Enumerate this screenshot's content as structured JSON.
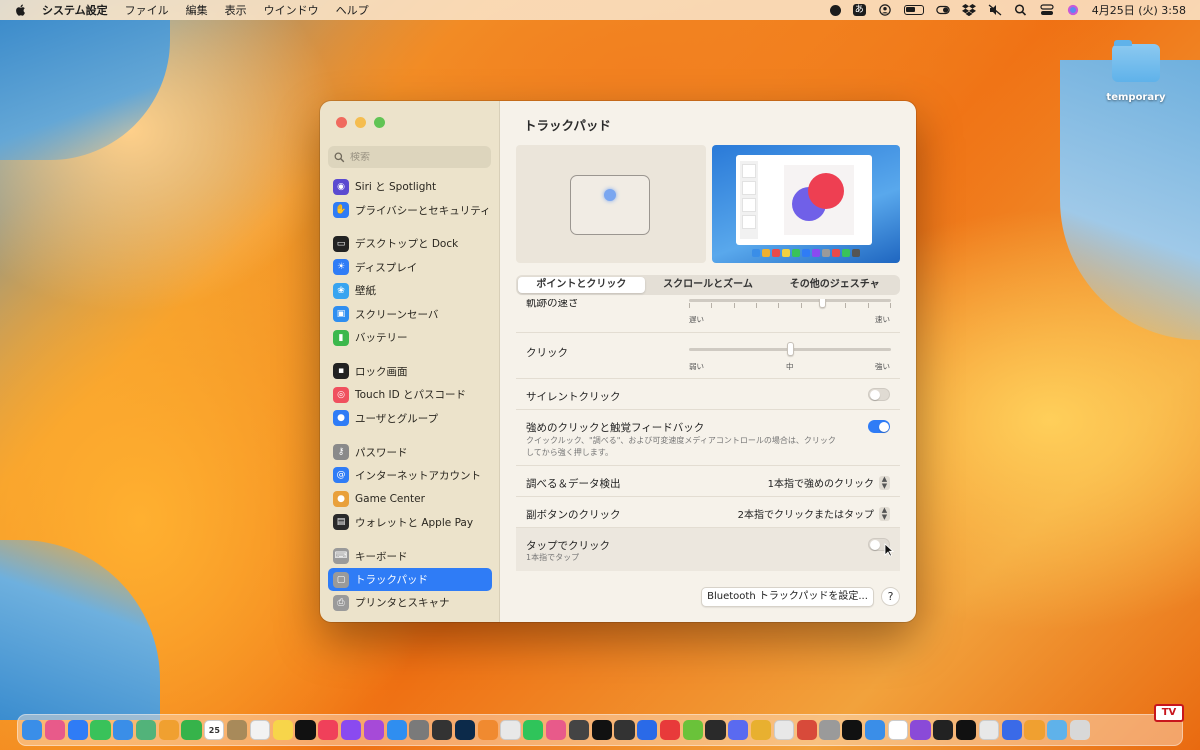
{
  "menubar": {
    "app_name": "システム設定",
    "menus": [
      "ファイル",
      "編集",
      "表示",
      "ウインドウ",
      "ヘルプ"
    ],
    "status_icons": [
      "record-icon",
      "input-method-icon",
      "user-icon",
      "battery-icon",
      "toggle-icon",
      "dropbox-icon",
      "mute-icon",
      "search-icon",
      "control-center-icon",
      "siri-icon"
    ],
    "input_method_label": "あ",
    "datetime": "4月25日 (火)  3:58"
  },
  "desktop": {
    "folder_label": "temporary"
  },
  "window": {
    "search_placeholder": "検索",
    "title": "トラックパッド",
    "sidebar": [
      {
        "label": "Siri と Spotlight",
        "icon": "siri-icon",
        "color": "#5b4ad0"
      },
      {
        "label": "プライバシーとセキュリティ",
        "icon": "hand-icon",
        "color": "#2f7cf6"
      },
      {
        "label": "デスクトップと Dock",
        "icon": "desktop-icon",
        "color": "#222222"
      },
      {
        "label": "ディスプレイ",
        "icon": "sun-icon",
        "color": "#2f7cf6"
      },
      {
        "label": "壁紙",
        "icon": "flower-icon",
        "color": "#38a4f0"
      },
      {
        "label": "スクリーンセーバ",
        "icon": "screensaver-icon",
        "color": "#2f8ef0"
      },
      {
        "label": "バッテリー",
        "icon": "battery-icon",
        "color": "#3cb84c"
      },
      {
        "label": "ロック画面",
        "icon": "lock-icon",
        "color": "#222222"
      },
      {
        "label": "Touch ID とパスコード",
        "icon": "fingerprint-icon",
        "color": "#f0505e"
      },
      {
        "label": "ユーザとグループ",
        "icon": "users-icon",
        "color": "#2f7cf6"
      },
      {
        "label": "パスワード",
        "icon": "key-icon",
        "color": "#8a8a8a"
      },
      {
        "label": "インターネットアカウント",
        "icon": "at-icon",
        "color": "#2f7cf6"
      },
      {
        "label": "Game Center",
        "icon": "game-center-icon",
        "color": "#e9a03a"
      },
      {
        "label": "ウォレットと Apple Pay",
        "icon": "wallet-icon",
        "color": "#2a2a2a"
      },
      {
        "label": "キーボード",
        "icon": "keyboard-icon",
        "color": "#9a9a9a"
      },
      {
        "label": "トラックパッド",
        "icon": "trackpad-icon",
        "color": "#9a9a9a"
      },
      {
        "label": "プリンタとスキャナ",
        "icon": "printer-icon",
        "color": "#9a9a9a"
      }
    ],
    "tabs": [
      "ポイントとクリック",
      "スクロールとズーム",
      "その他のジェスチャ"
    ],
    "active_tab": "ポイントとクリック",
    "rows": {
      "tracking": {
        "label": "軌跡の速さ",
        "min_label": "遅い",
        "max_label": "速い",
        "value": 0.66
      },
      "click": {
        "label": "クリック",
        "min_label": "弱い",
        "mid_label": "中",
        "max_label": "強い",
        "value": 0.5
      },
      "silent_click": {
        "label": "サイレントクリック",
        "on": false
      },
      "force_click": {
        "label": "強めのクリックと触覚フィードバック",
        "desc_1": "クイックルック、\"調べる\"、および可変速度メディアコントロールの場合は、クリック",
        "desc_2": "してから強く押します。",
        "on": true
      },
      "lookup": {
        "label": "調べる＆データ検出",
        "value": "1本指で強めのクリック"
      },
      "secondary_click": {
        "label": "副ボタンのクリック",
        "value": "2本指でクリックまたはタップ"
      },
      "tap_to_click": {
        "label": "タップでクリック",
        "desc": "1本指でタップ",
        "on": false
      }
    },
    "bluetooth_button": "Bluetooth トラックパッドを設定...",
    "help_button": "?"
  },
  "dock": {
    "calendar_day": "25",
    "tv_logo": "TV",
    "apps": [
      {
        "name": "finder",
        "color": "#3a8ee8"
      },
      {
        "name": "launchpad",
        "color": "#e85a8a"
      },
      {
        "name": "safari",
        "color": "#2f7cf6"
      },
      {
        "name": "messages",
        "color": "#39c25a"
      },
      {
        "name": "mail",
        "color": "#3a8ee8"
      },
      {
        "name": "maps",
        "color": "#52b37a"
      },
      {
        "name": "photos",
        "color": "#f0a030"
      },
      {
        "name": "facetime",
        "color": "#36b34a"
      },
      {
        "name": "calendar",
        "color": "#ffffff"
      },
      {
        "name": "notes-brown",
        "color": "#a88a5a"
      },
      {
        "name": "reminders",
        "color": "#f2f2f2"
      },
      {
        "name": "notes",
        "color": "#f7d54a"
      },
      {
        "name": "tv",
        "color": "#111111"
      },
      {
        "name": "music",
        "color": "#f0405a"
      },
      {
        "name": "itunes-star",
        "color": "#8a4af0"
      },
      {
        "name": "podcasts",
        "color": "#a64ad8"
      },
      {
        "name": "app-store",
        "color": "#2f8ef0"
      },
      {
        "name": "settings",
        "color": "#7a7a7a"
      },
      {
        "name": "claquette",
        "color": "#333333"
      },
      {
        "name": "photoshop",
        "color": "#0c2a4a"
      },
      {
        "name": "pages",
        "color": "#f08a30"
      },
      {
        "name": "pigeon",
        "color": "#e8e8e8"
      },
      {
        "name": "line",
        "color": "#2fc45a"
      },
      {
        "name": "screens",
        "color": "#e85a8a"
      },
      {
        "name": "obs",
        "color": "#444444"
      },
      {
        "name": "typing",
        "color": "#111111"
      },
      {
        "name": "keyboard-app",
        "color": "#333333"
      },
      {
        "name": "sketch",
        "color": "#2a6ae8"
      },
      {
        "name": "megaphone",
        "color": "#e83a3a"
      },
      {
        "name": "green-app",
        "color": "#6ac23a"
      },
      {
        "name": "notebook",
        "color": "#2a2a2a"
      },
      {
        "name": "messenger",
        "color": "#5a6af0"
      },
      {
        "name": "face-app",
        "color": "#e8b030"
      },
      {
        "name": "chrome",
        "color": "#e8e8e8"
      },
      {
        "name": "mirror",
        "color": "#d84a3a"
      },
      {
        "name": "gear-app",
        "color": "#9a9a9a"
      },
      {
        "name": "grapher",
        "color": "#111111"
      },
      {
        "name": "preview",
        "color": "#3a8ee8"
      },
      {
        "name": "google",
        "color": "#ffffff"
      },
      {
        "name": "itunes-purple",
        "color": "#8a4ad8"
      },
      {
        "name": "waves",
        "color": "#222222"
      },
      {
        "name": "capcut",
        "color": "#111111"
      },
      {
        "name": "tableplus",
        "color": "#e8e8e8"
      },
      {
        "name": "firefox",
        "color": "#3a6ae8"
      },
      {
        "name": "star-app",
        "color": "#f0a030"
      },
      {
        "name": "folder",
        "color": "#5fb2ea"
      },
      {
        "name": "trash",
        "color": "#d8d8d8"
      }
    ]
  }
}
